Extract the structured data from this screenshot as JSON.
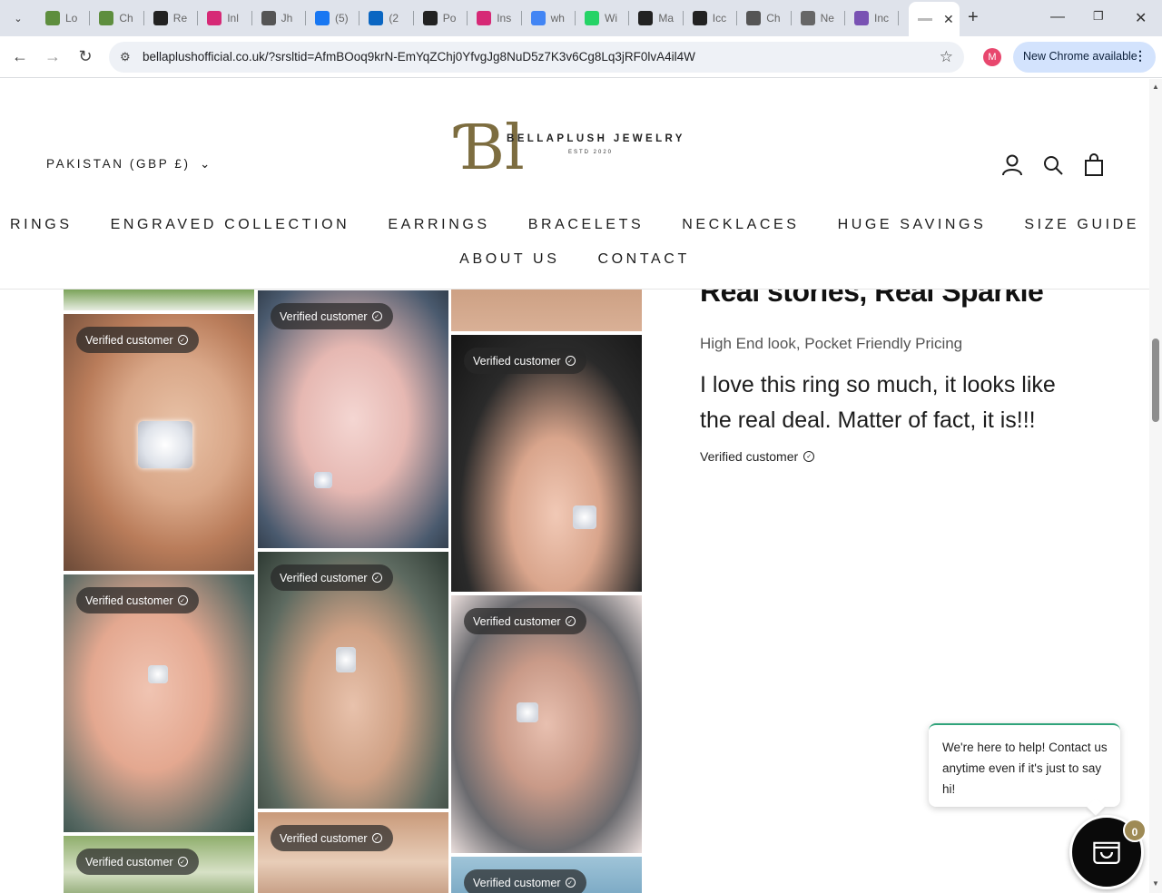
{
  "browser": {
    "tabs": [
      {
        "label": "Lo",
        "favicon": "shopify-icon",
        "color": "#5e8e3e"
      },
      {
        "label": "Ch",
        "favicon": "shopify-icon",
        "color": "#5e8e3e"
      },
      {
        "label": "Re",
        "favicon": "slashed-circle-icon",
        "color": "#222222"
      },
      {
        "label": "Inl",
        "favicon": "instagram-icon",
        "color": "#d62976"
      },
      {
        "label": "Jh",
        "favicon": "nsb-icon",
        "color": "#555555"
      },
      {
        "label": "(5)",
        "favicon": "facebook-icon",
        "color": "#1877f2"
      },
      {
        "label": "(2",
        "favicon": "linkedin-icon",
        "color": "#0a66c2"
      },
      {
        "label": "Po",
        "favicon": "openai-icon",
        "color": "#222222"
      },
      {
        "label": "Ins",
        "favicon": "instagram-icon",
        "color": "#d62976"
      },
      {
        "label": "wh",
        "favicon": "google-icon",
        "color": "#4285f4"
      },
      {
        "label": "Wi",
        "favicon": "whatsapp-icon",
        "color": "#25d366"
      },
      {
        "label": "Ma",
        "favicon": "slashed-circle-icon",
        "color": "#222222"
      },
      {
        "label": "Icc",
        "favicon": "openai-icon",
        "color": "#222222"
      },
      {
        "label": "Ch",
        "favicon": "nsb-icon",
        "color": "#555555"
      },
      {
        "label": "Ne",
        "favicon": "chrome-icon",
        "color": "#666666"
      },
      {
        "label": "Inc",
        "favicon": "bootstrap-icon",
        "color": "#7952b3"
      }
    ],
    "active_tab_label": "",
    "url": "bellaplushofficial.co.uk/?srsltid=AfmBOoq9krN-EmYqZChj0YfvgJg8NuD5z7K3v6Cg8Lq3jRF0lvA4il4W",
    "profile_initial": "M",
    "update_label": "New Chrome available"
  },
  "header": {
    "country_selector": "PAKISTAN (GBP £)",
    "logo": {
      "monogram": "Ɓl",
      "brand": "BELLAPLUSH JEWELRY",
      "estd": "ESTD 2020"
    },
    "nav_row1": [
      "RINGS",
      "ENGRAVED COLLECTION",
      "EARRINGS",
      "BRACELETS",
      "NECKLACES",
      "HUGE SAVINGS",
      "SIZE GUIDE"
    ],
    "nav_row2": [
      "ABOUT US",
      "CONTACT"
    ]
  },
  "gallery": {
    "badge_label": "Verified customer"
  },
  "review": {
    "title": "Real stories, Real Sparkle",
    "subtitle": "High End look, Pocket Friendly Pricing",
    "quote": "I love this ring so much, it looks like the real deal. Matter of fact, it is!!!",
    "author": "Verified customer"
  },
  "chat": {
    "message": "We're here to help! Contact us anytime even if it's just to say hi!",
    "cart_count": "0"
  },
  "colors": {
    "brand_gold": "#7d6d40",
    "badge_bg": "#9e8a55",
    "accent_green": "#2fa37a"
  }
}
